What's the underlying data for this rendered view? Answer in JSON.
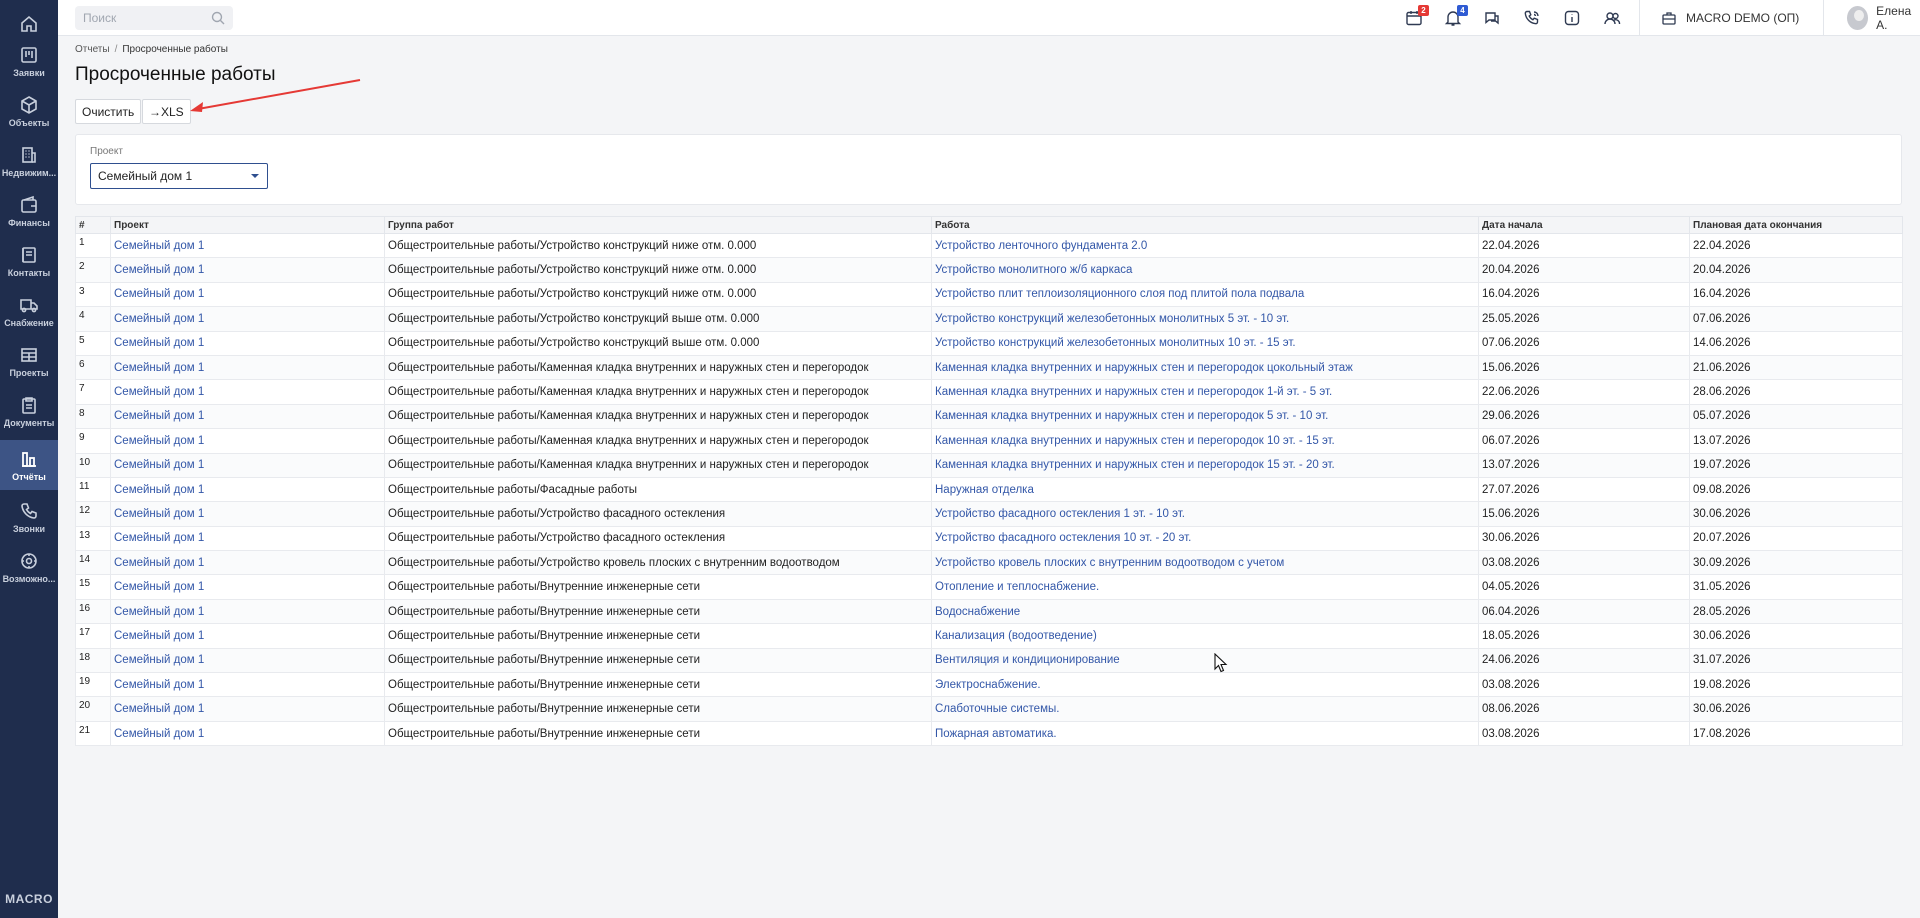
{
  "sidebar": {
    "items": [
      {
        "label": "",
        "icon": "home-icon"
      },
      {
        "label": "Заявки",
        "icon": "kanban-icon"
      },
      {
        "label": "Объекты",
        "icon": "cube-icon"
      },
      {
        "label": "Недвижим...",
        "icon": "building-icon"
      },
      {
        "label": "Финансы",
        "icon": "wallet-icon"
      },
      {
        "label": "Контакты",
        "icon": "contacts-icon"
      },
      {
        "label": "Снабжение",
        "icon": "truck-icon"
      },
      {
        "label": "Проекты",
        "icon": "projects-icon"
      },
      {
        "label": "Документы",
        "icon": "clipboard-icon"
      },
      {
        "label": "Отчёты",
        "icon": "chart-icon"
      },
      {
        "label": "Звонки",
        "icon": "phone-icon"
      },
      {
        "label": "Возможно...",
        "icon": "gear-icon"
      }
    ],
    "brand": "MACRO"
  },
  "topbar": {
    "search_placeholder": "Поиск",
    "calendar_badge": "2",
    "bell_badge": "4",
    "company": "MACRO DEMO (ОП)",
    "user": "Елена А."
  },
  "breadcrumb": {
    "root": "Отчеты",
    "current": "Просроченные работы"
  },
  "page": {
    "title": "Просроченные работы"
  },
  "toolbar": {
    "clear_label": "Очистить",
    "xls_label": "→XLS"
  },
  "filter": {
    "label": "Проект",
    "value": "Семейный дом 1"
  },
  "table": {
    "headers": [
      "#",
      "Проект",
      "Группа работ",
      "Работа",
      "Дата начала",
      "Плановая дата окончания"
    ],
    "rows": [
      [
        "1",
        "Семейный дом 1",
        "Общестроительные работы/Устройство конструкций ниже отм. 0.000",
        "Устройство ленточного фундамента 2.0",
        "22.04.2026",
        "22.04.2026"
      ],
      [
        "2",
        "Семейный дом 1",
        "Общестроительные работы/Устройство конструкций ниже отм. 0.000",
        "Устройство монолитного ж/б каркаса",
        "20.04.2026",
        "20.04.2026"
      ],
      [
        "3",
        "Семейный дом 1",
        "Общестроительные работы/Устройство конструкций ниже отм. 0.000",
        "Устройство плит теплоизоляционного слоя под плитой пола подвала",
        "16.04.2026",
        "16.04.2026"
      ],
      [
        "4",
        "Семейный дом 1",
        "Общестроительные работы/Устройство конструкций выше отм. 0.000",
        "Устройство конструкций железобетонных монолитных 5 эт. - 10 эт.",
        "25.05.2026",
        "07.06.2026"
      ],
      [
        "5",
        "Семейный дом 1",
        "Общестроительные работы/Устройство конструкций выше отм. 0.000",
        "Устройство конструкций железобетонных монолитных 10 эт. - 15 эт.",
        "07.06.2026",
        "14.06.2026"
      ],
      [
        "6",
        "Семейный дом 1",
        "Общестроительные работы/Каменная кладка внутренних и наружных стен и перегородок",
        "Каменная кладка внутренних и наружных стен и перегородок цокольный этаж",
        "15.06.2026",
        "21.06.2026"
      ],
      [
        "7",
        "Семейный дом 1",
        "Общестроительные работы/Каменная кладка внутренних и наружных стен и перегородок",
        "Каменная кладка внутренних и наружных стен и перегородок 1-й эт. - 5 эт.",
        "22.06.2026",
        "28.06.2026"
      ],
      [
        "8",
        "Семейный дом 1",
        "Общестроительные работы/Каменная кладка внутренних и наружных стен и перегородок",
        "Каменная кладка внутренних и наружных стен и перегородок  5 эт. - 10 эт.",
        "29.06.2026",
        "05.07.2026"
      ],
      [
        "9",
        "Семейный дом 1",
        "Общестроительные работы/Каменная кладка внутренних и наружных стен и перегородок",
        "Каменная кладка внутренних и наружных стен и перегородок  10 эт. - 15 эт.",
        "06.07.2026",
        "13.07.2026"
      ],
      [
        "10",
        "Семейный дом 1",
        "Общестроительные работы/Каменная кладка внутренних и наружных стен и перегородок",
        "Каменная кладка внутренних и наружных стен и перегородок  15 эт. - 20 эт.",
        "13.07.2026",
        "19.07.2026"
      ],
      [
        "11",
        "Семейный дом 1",
        "Общестроительные работы/Фасадные работы",
        "Наружная отделка",
        "27.07.2026",
        "09.08.2026"
      ],
      [
        "12",
        "Семейный дом 1",
        "Общестроительные работы/Устройство фасадного остекления",
        "Устройство фасадного остекления 1 эт. - 10 эт.",
        "15.06.2026",
        "30.06.2026"
      ],
      [
        "13",
        "Семейный дом 1",
        "Общестроительные работы/Устройство фасадного остекления",
        "Устройство фасадного остекления 10 эт. - 20 эт.",
        "30.06.2026",
        "20.07.2026"
      ],
      [
        "14",
        "Семейный дом 1",
        "Общестроительные работы/Устройство кровель плоских с внутренним водоотводом",
        "Устройство кровель плоских с внутренним водоотводом с учетом",
        "03.08.2026",
        "30.09.2026"
      ],
      [
        "15",
        "Семейный дом 1",
        "Общестроительные работы/Внутренние инженерные сети",
        "Отопление и теплоснабжение.",
        "04.05.2026",
        "31.05.2026"
      ],
      [
        "16",
        "Семейный дом 1",
        "Общестроительные работы/Внутренние инженерные сети",
        "Водоснабжение",
        "06.04.2026",
        "28.05.2026"
      ],
      [
        "17",
        "Семейный дом 1",
        "Общестроительные работы/Внутренние инженерные сети",
        "Канализация (водоотведение)",
        "18.05.2026",
        "30.06.2026"
      ],
      [
        "18",
        "Семейный дом 1",
        "Общестроительные работы/Внутренние инженерные сети",
        "Вентиляция и кондиционирование",
        "24.06.2026",
        "31.07.2026"
      ],
      [
        "19",
        "Семейный дом 1",
        "Общестроительные работы/Внутренние инженерные сети",
        "Электроснабжение.",
        "03.08.2026",
        "19.08.2026"
      ],
      [
        "20",
        "Семейный дом 1",
        "Общестроительные работы/Внутренние инженерные сети",
        "Слаботочные системы.",
        "08.06.2026",
        "30.06.2026"
      ],
      [
        "21",
        "Семейный дом 1",
        "Общестроительные работы/Внутренние инженерные сети",
        "Пожарная автоматика.",
        "03.08.2026",
        "17.08.2026"
      ]
    ]
  },
  "colors": {
    "sidebar_bg": "#1f2d4d",
    "active_item": "#3d5485",
    "link": "#3357a8",
    "badge_red": "#e53935",
    "badge_blue": "#2f5bd3",
    "annotation_arrow": "#e53935"
  }
}
